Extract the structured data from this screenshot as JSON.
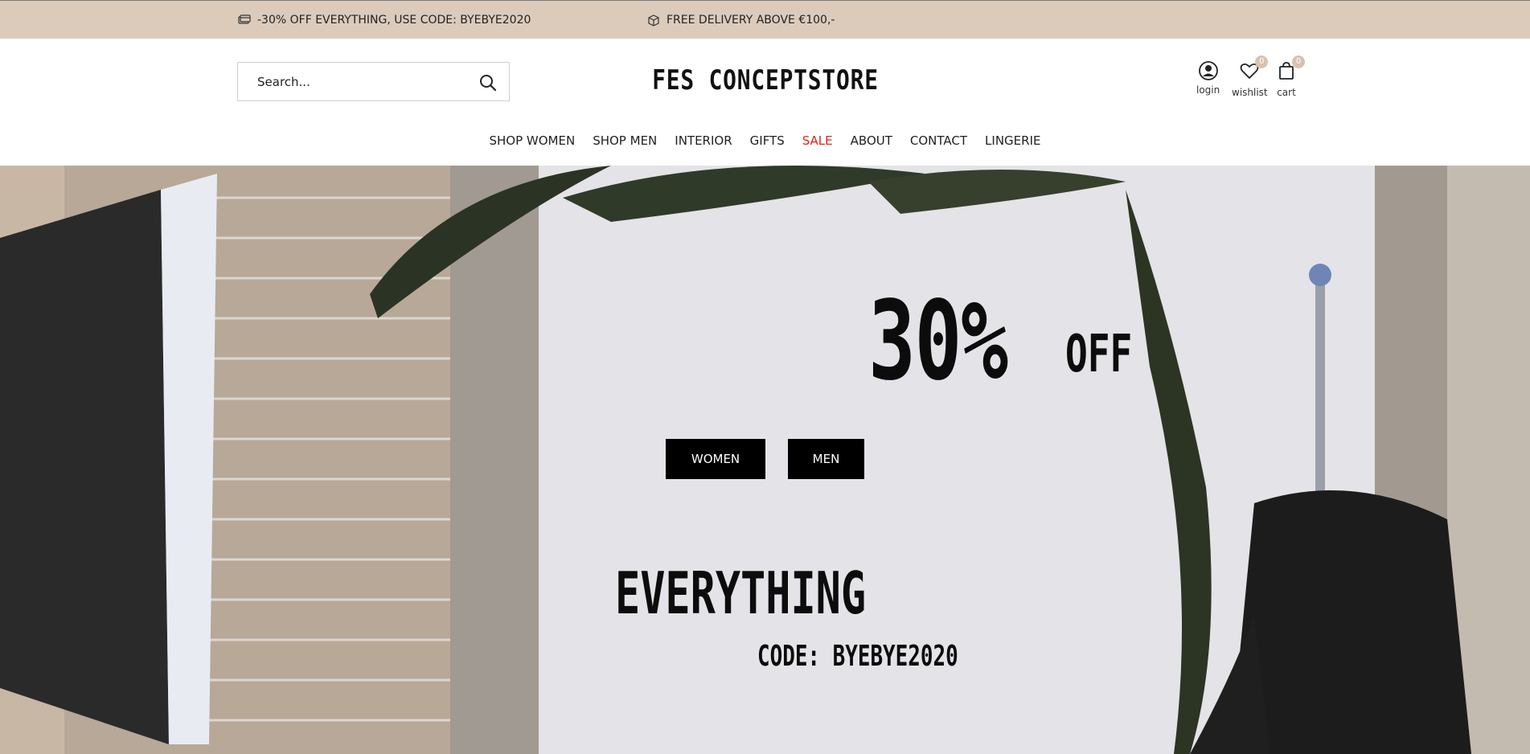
{
  "promos": [
    {
      "icon": "credit-card-icon",
      "text": "-30% OFF EVERYTHING, USE CODE: BYEBYE2020"
    },
    {
      "icon": "box-icon",
      "text": "FREE DELIVERY ABOVE €100,-"
    }
  ],
  "search": {
    "placeholder": "Search..."
  },
  "logo": "FES CONCEPTSTORE",
  "actions": {
    "login": {
      "label": "login",
      "icon": "user-icon"
    },
    "wishlist": {
      "label": "wishlist",
      "count": "0",
      "icon": "heart-icon"
    },
    "cart": {
      "label": "cart",
      "count": "0",
      "icon": "shopping-bag-icon"
    }
  },
  "nav": [
    "SHOP WOMEN",
    "SHOP MEN",
    "INTERIOR",
    "GIFTS",
    "SALE",
    "ABOUT",
    "CONTACT",
    "LINGERIE"
  ],
  "hero": {
    "percent": "30%",
    "off": "OFF",
    "buttons": [
      "WOMEN",
      "MEN"
    ],
    "everything": "EVERYTHING",
    "code": "CODE: BYEBYE2020"
  },
  "colors": {
    "topbar": "#dccbbb",
    "sale": "#e2231a",
    "badge": "#d7c3af"
  }
}
